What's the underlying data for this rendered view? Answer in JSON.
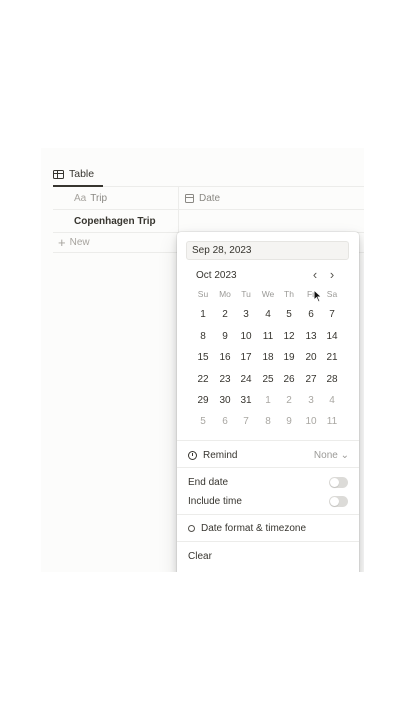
{
  "view": {
    "tab_label": "Table"
  },
  "table": {
    "columns": [
      {
        "prefix": "Aa",
        "label": "Trip"
      },
      {
        "label": "Date"
      }
    ],
    "rows": [
      {
        "trip": "Copenhagen Trip",
        "date": ""
      }
    ],
    "new_row_label": "New"
  },
  "date_picker": {
    "input_value": "Sep 28, 2023",
    "month_label": "Oct 2023",
    "weekdays": [
      "Su",
      "Mo",
      "Tu",
      "We",
      "Th",
      "Fr",
      "Sa"
    ],
    "weeks": [
      [
        1,
        2,
        3,
        4,
        5,
        6,
        7
      ],
      [
        8,
        9,
        10,
        11,
        12,
        13,
        14
      ],
      [
        15,
        16,
        17,
        18,
        19,
        20,
        21
      ],
      [
        22,
        23,
        24,
        25,
        26,
        27,
        28
      ],
      [
        29,
        30,
        31,
        1,
        2,
        3,
        4
      ],
      [
        5,
        6,
        7,
        8,
        9,
        10,
        11
      ]
    ],
    "remind_label": "Remind",
    "remind_value": "None",
    "end_date_label": "End date",
    "end_date_on": false,
    "include_time_label": "Include time",
    "include_time_on": false,
    "format_label": "Date format & timezone",
    "clear_label": "Clear"
  }
}
